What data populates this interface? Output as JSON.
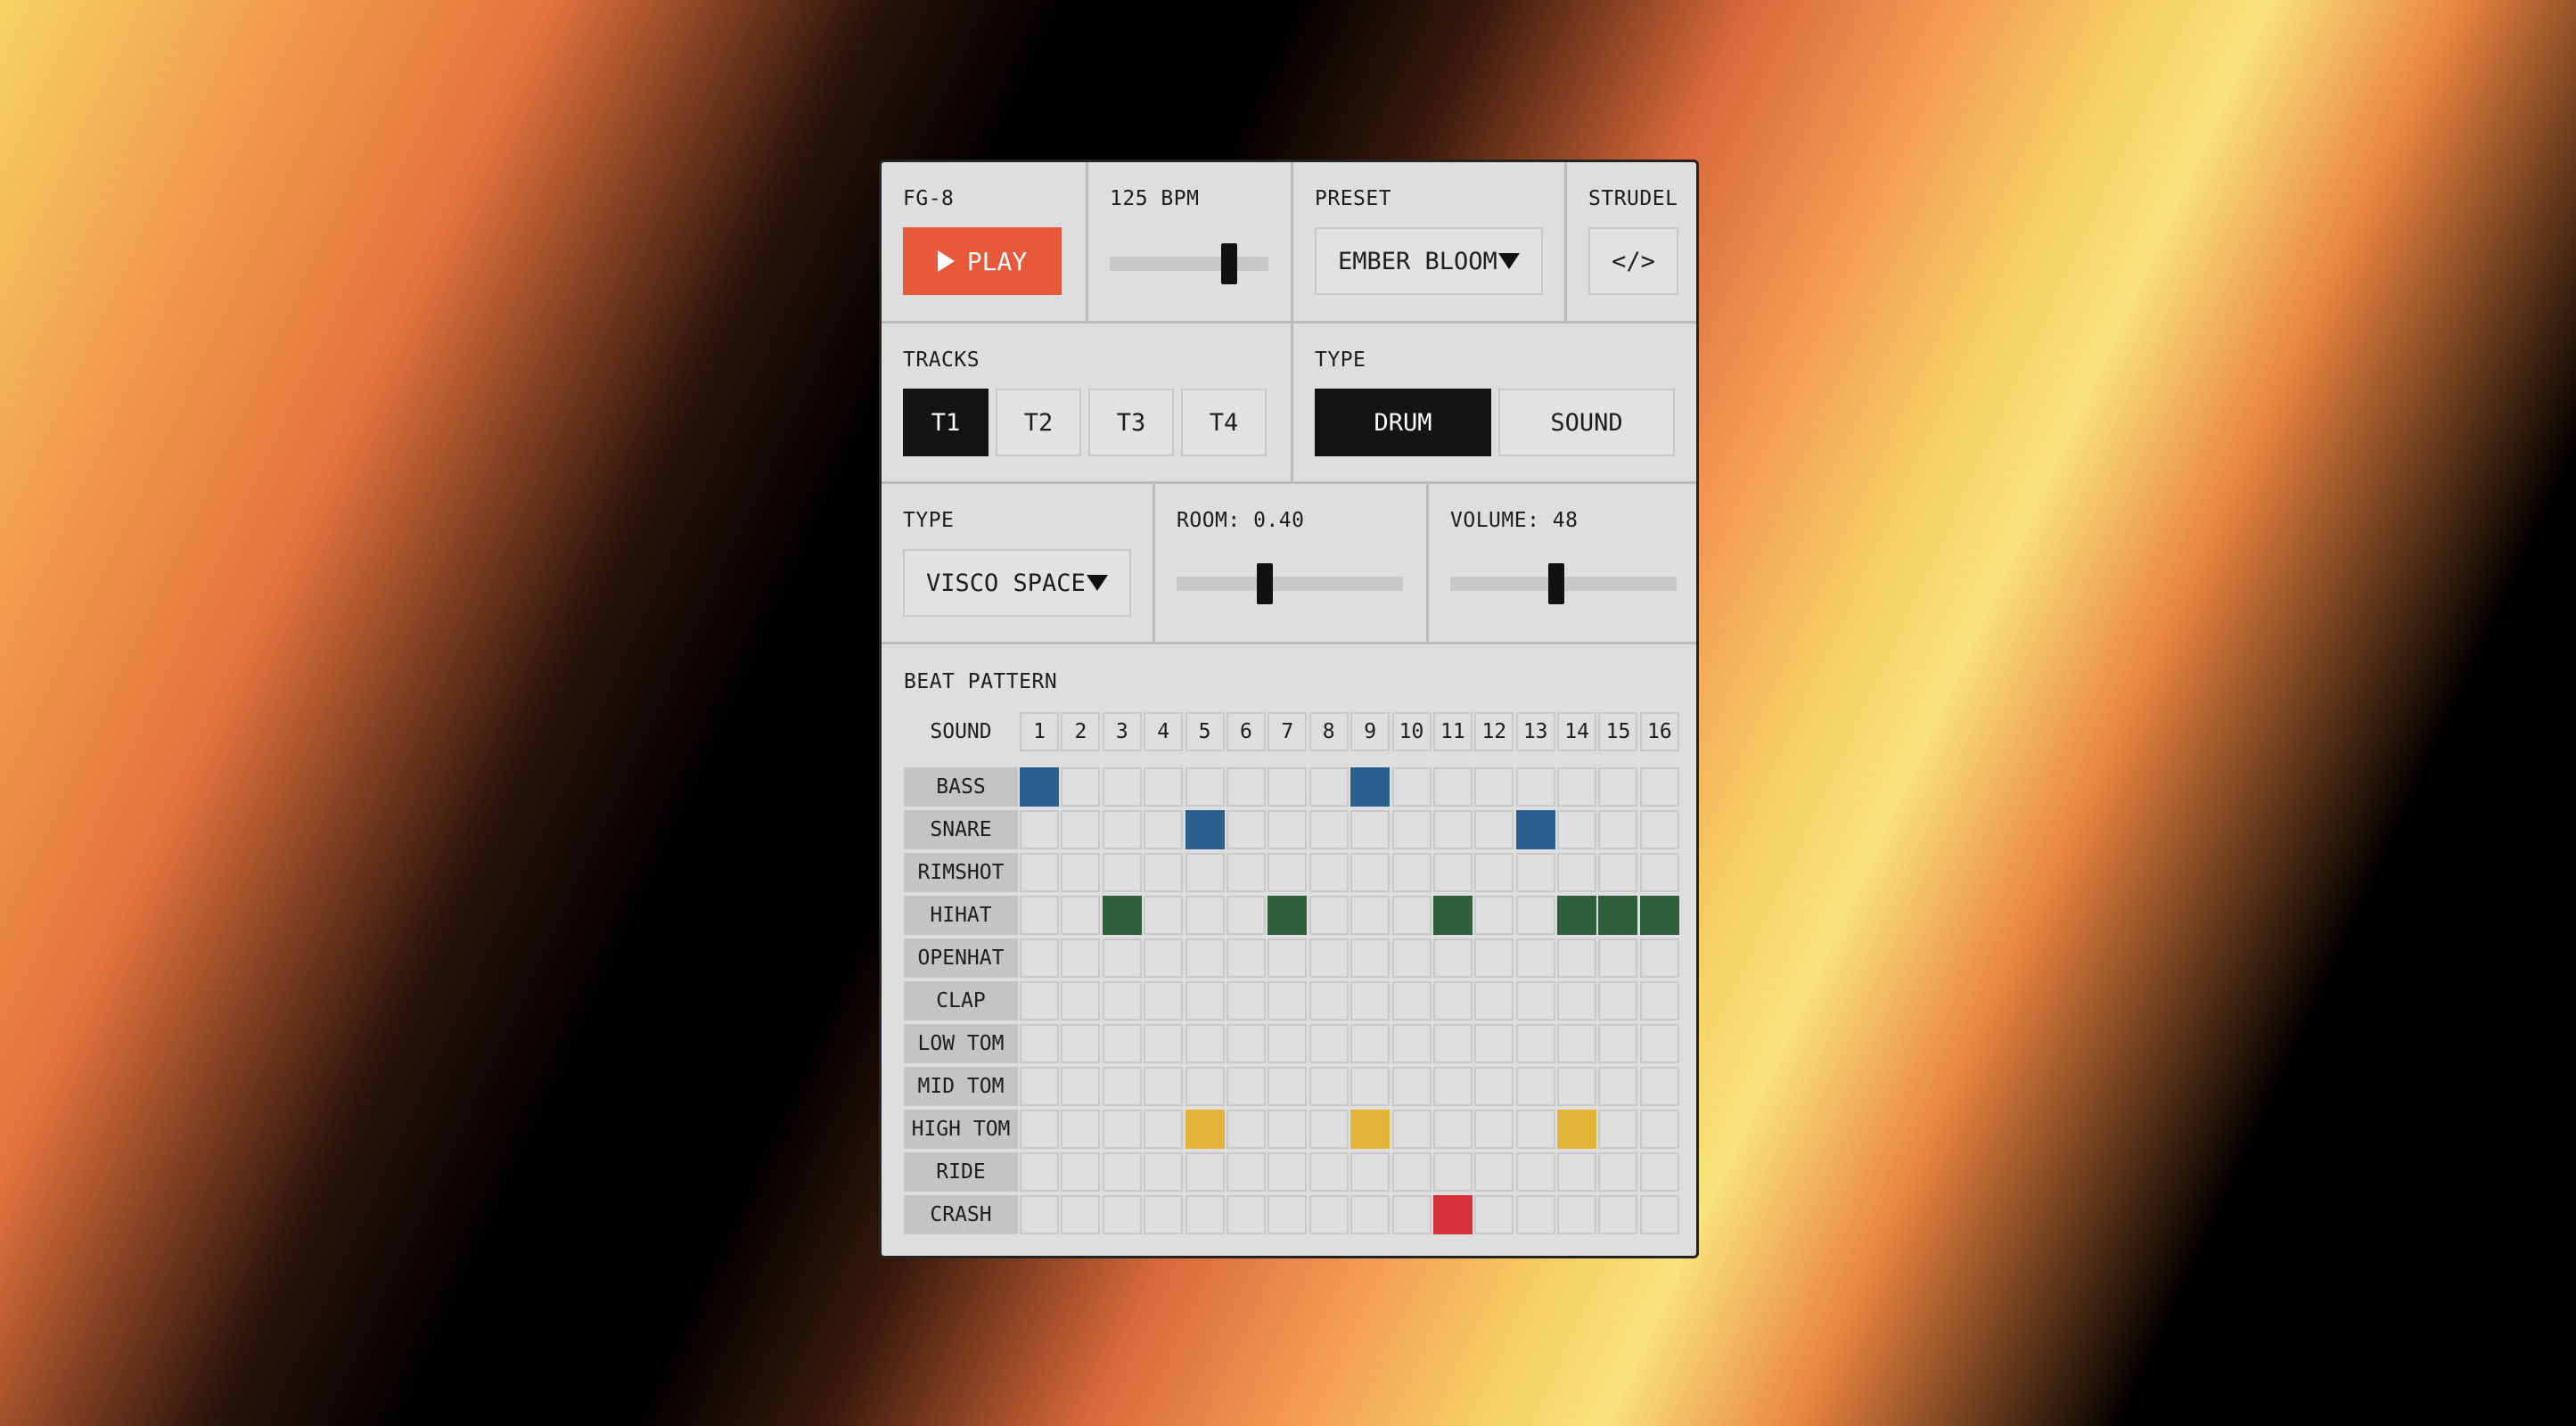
{
  "app": {
    "name": "FG-8",
    "play_label": "PLAY"
  },
  "tempo": {
    "label": "125 BPM",
    "value": 125,
    "level": 0.72
  },
  "preset": {
    "label": "PRESET",
    "value": "EMBER BLOOM"
  },
  "strudel": {
    "label": "STRUDEL",
    "button": "</>"
  },
  "tracks": {
    "label": "TRACKS",
    "items": [
      "T1",
      "T2",
      "T3",
      "T4"
    ],
    "active": "T1"
  },
  "type": {
    "label": "TYPE",
    "items": [
      "DRUM",
      "SOUND"
    ],
    "active": "DRUM"
  },
  "reverb": {
    "type_label": "TYPE",
    "type_value": "VISCO SPACE",
    "room_label": "ROOM: 0.40",
    "room_level": 0.4,
    "volume_label": "VOLUME: 48",
    "volume_level": 0.48
  },
  "pattern": {
    "label": "BEAT PATTERN",
    "sound_header": "SOUND",
    "steps": [
      "1",
      "2",
      "3",
      "4",
      "5",
      "6",
      "7",
      "8",
      "9",
      "10",
      "11",
      "12",
      "13",
      "14",
      "15",
      "16"
    ],
    "rows": [
      {
        "name": "BASS",
        "on": [
          1,
          9
        ],
        "color": "#2a5f8e"
      },
      {
        "name": "SNARE",
        "on": [
          5,
          13
        ],
        "color": "#2a5f8e"
      },
      {
        "name": "RIMSHOT",
        "on": [],
        "color": "#2a5f8e"
      },
      {
        "name": "HIHAT",
        "on": [
          3,
          7,
          11,
          14,
          15,
          16
        ],
        "color": "#2e5e3a"
      },
      {
        "name": "OPENHAT",
        "on": [],
        "color": "#2e5e3a"
      },
      {
        "name": "CLAP",
        "on": [],
        "color": "#2e5e3a"
      },
      {
        "name": "LOW TOM",
        "on": [],
        "color": "#e2b53a"
      },
      {
        "name": "MID TOM",
        "on": [],
        "color": "#e2b53a"
      },
      {
        "name": "HIGH TOM",
        "on": [
          5,
          9,
          14
        ],
        "color": "#e2b53a"
      },
      {
        "name": "RIDE",
        "on": [],
        "color": "#d8303b"
      },
      {
        "name": "CRASH",
        "on": [
          11
        ],
        "color": "#d8303b"
      }
    ]
  }
}
